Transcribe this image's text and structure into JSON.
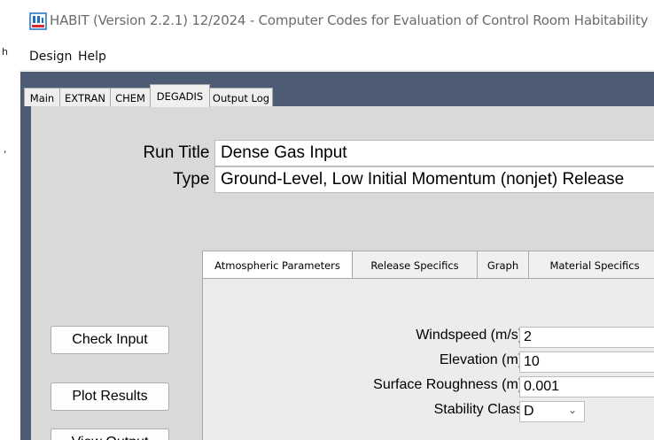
{
  "window": {
    "title": "HABIT  (Version 2.2.1) 12/2024 - Computer Codes for Evaluation of Control Room Habitability"
  },
  "menu": [
    "Design",
    "Help"
  ],
  "tabs": [
    "Main",
    "EXTRAN",
    "CHEM",
    "DEGADIS",
    "Output Log"
  ],
  "active_tab": "DEGADIS",
  "form": {
    "run_title_label": "Run Title :",
    "run_title_value": "Dense Gas Input",
    "type_label": "Type :",
    "type_value": "Ground-Level, Low Initial Momentum (nonjet) Release"
  },
  "subtabs": [
    "Atmospheric Parameters",
    "Release Specifics",
    "Graph",
    "Material Specifics"
  ],
  "active_subtab": "Atmospheric Parameters",
  "buttons": {
    "check_input": "Check Input",
    "plot_results": "Plot Results",
    "view_output": "View Output"
  },
  "atmos": {
    "windspeed_label": "Windspeed (m/s) :",
    "windspeed_value": "2",
    "elevation_label": "Elevation (m) :",
    "elevation_value": "10",
    "roughness_label": "Surface Roughness (m) :",
    "roughness_value": "0.001",
    "stability_label": "Stability Class :",
    "stability_value": "D"
  },
  "icons": [
    "app-icon",
    "chevron-down-icon"
  ],
  "colors": {
    "frame": "#4e5b75",
    "panel": "#d9d9d9",
    "icon_accent": "#1f6fc4",
    "icon_red": "#d22b2b"
  }
}
